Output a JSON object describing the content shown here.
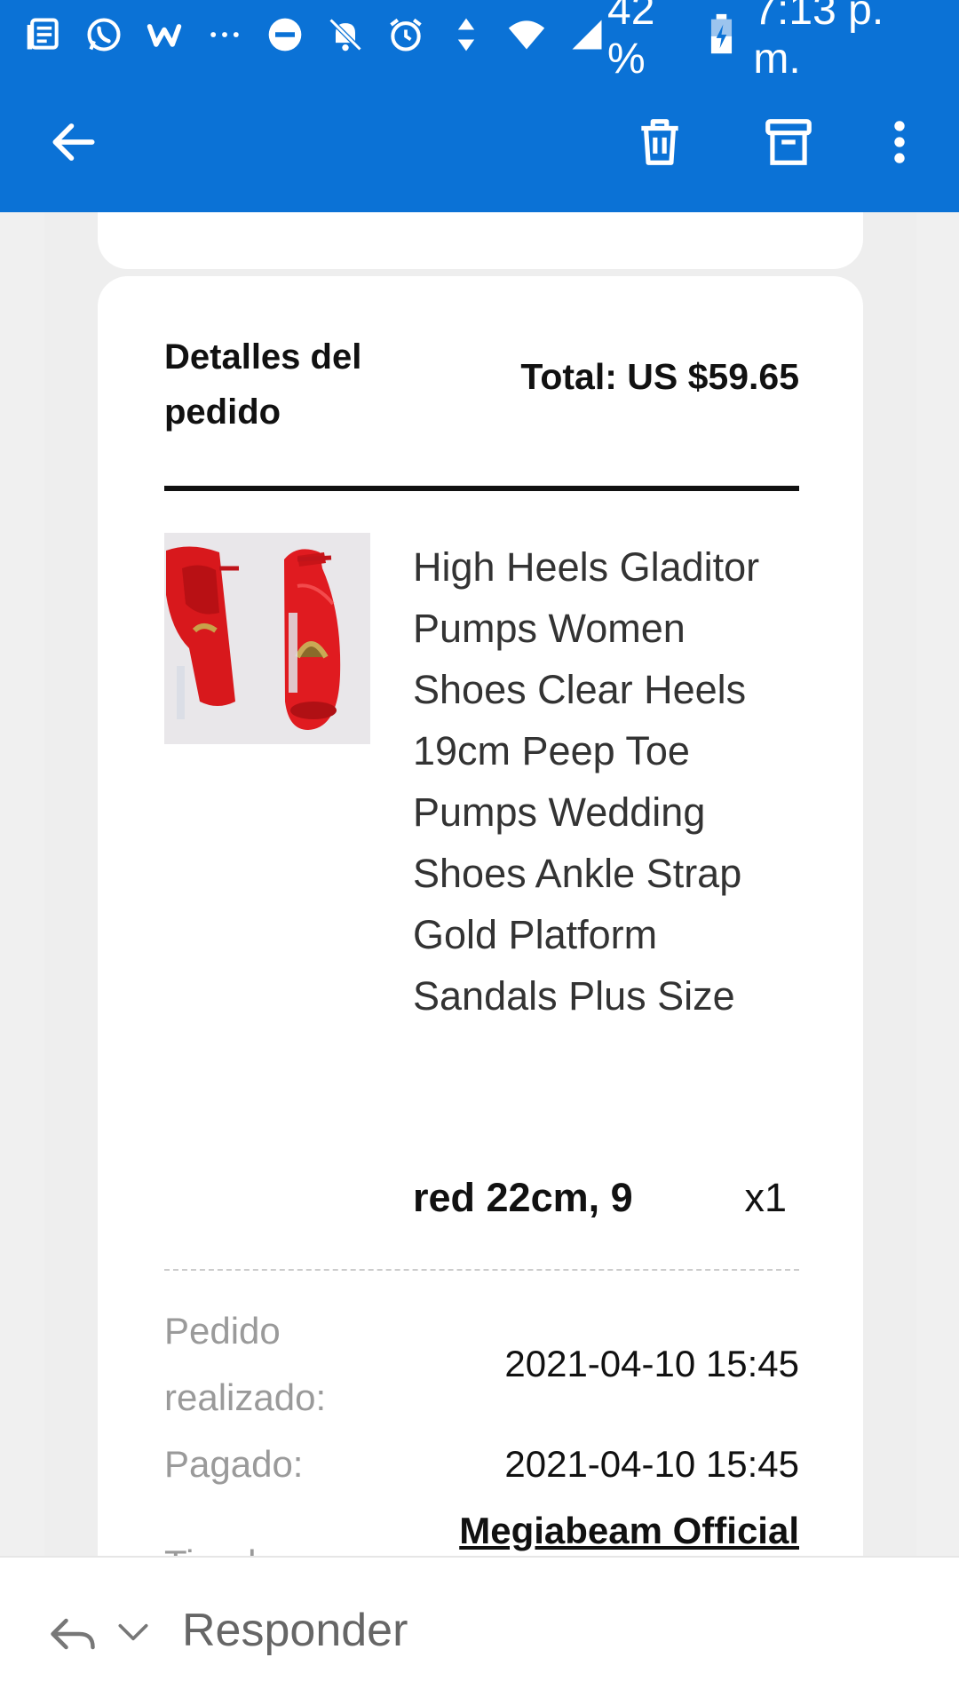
{
  "status_bar": {
    "icons": [
      "notes-icon",
      "whatsapp-icon",
      "w-app-icon",
      "more-dots-icon",
      "do-not-disturb-icon",
      "notifications-off-icon",
      "alarm-icon",
      "data-arrows-icon",
      "wifi-icon",
      "signal-icon"
    ],
    "battery": "42 %",
    "time": "7:13 p. m."
  },
  "app_bar": {
    "icons": [
      "back-arrow-icon",
      "trash-icon",
      "archive-icon",
      "overflow-menu-icon"
    ],
    "color": "#0b72d6"
  },
  "order": {
    "title": "Detalles del pedido",
    "total": "Total: US $59.65",
    "product_name": "High Heels Gladitor Pumps Women Shoes Clear Heels 19cm Peep Toe Pumps Wedding Shoes Ankle Strap Gold Platform Sandals Plus Size",
    "variant": "red 22cm, 9",
    "quantity": "x1",
    "details": {
      "placed_label": "Pedido realizado:",
      "placed_value": "2021-04-10 15:45",
      "paid_label": "Pagado:",
      "paid_value": "2021-04-10 15:45",
      "store_label": "Tienda:",
      "store_value": "Megiabeam Official Store"
    }
  },
  "reply_bar": {
    "label": "Responder"
  }
}
